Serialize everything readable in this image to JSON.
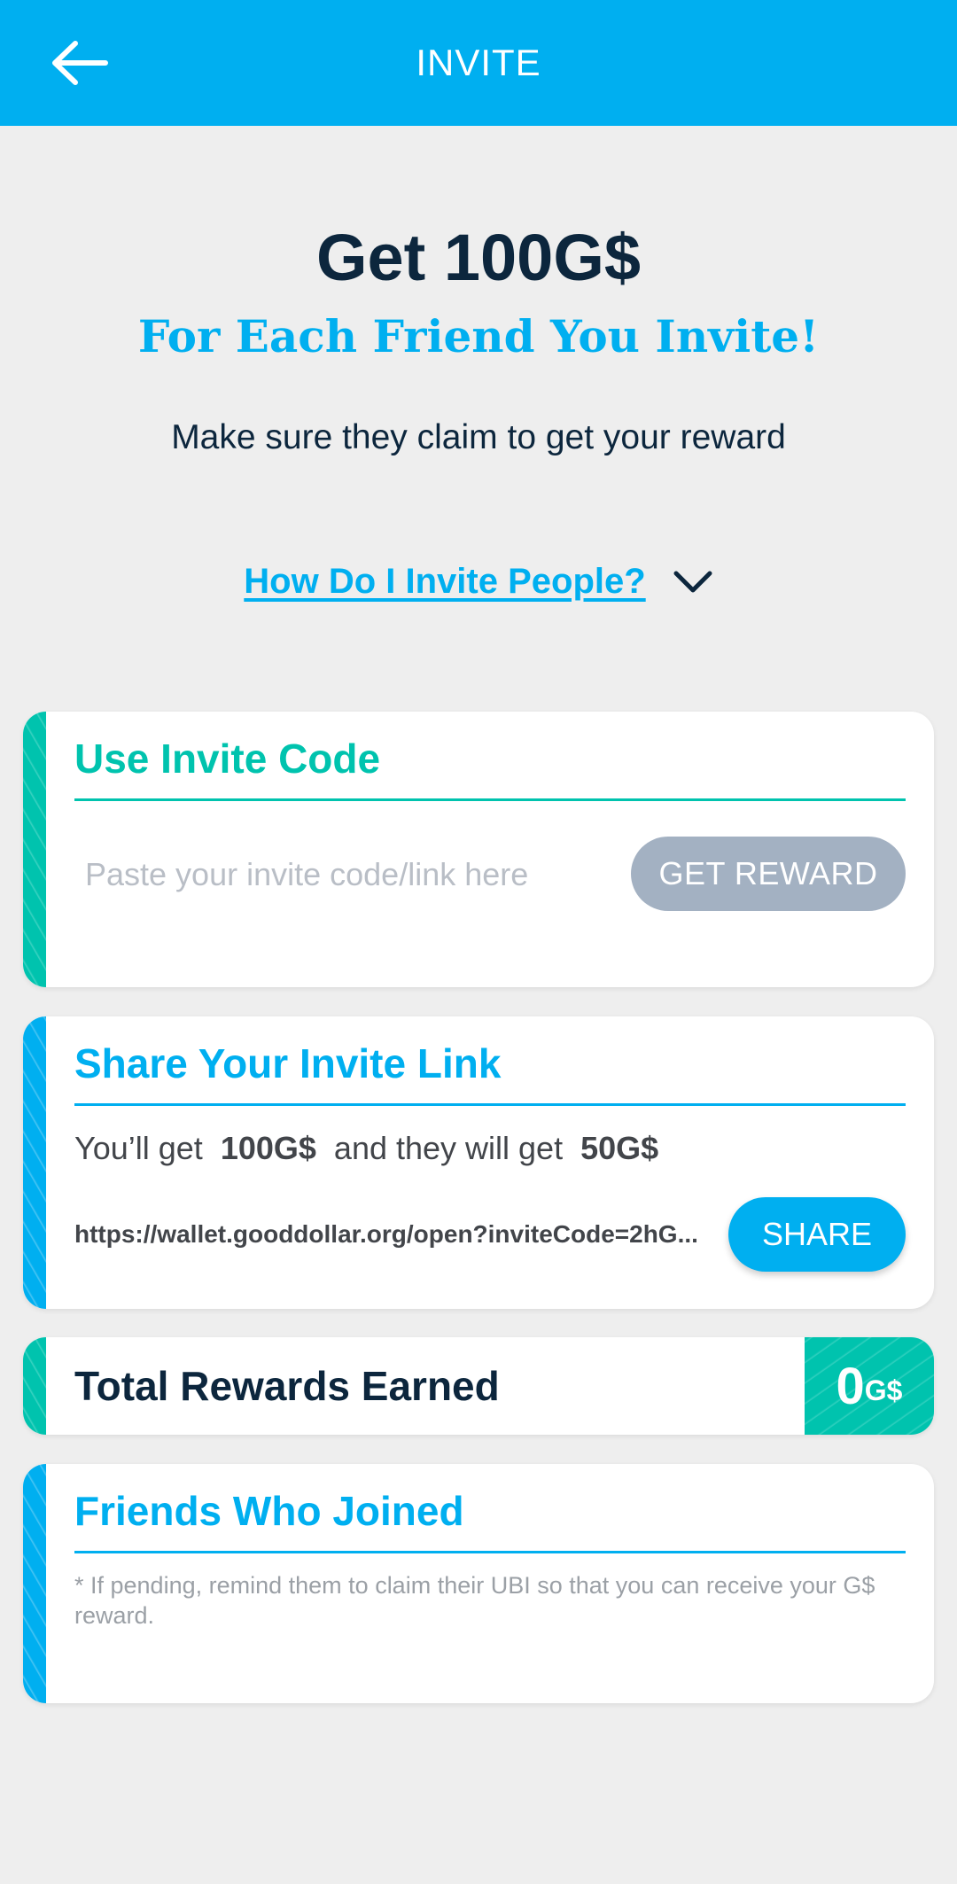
{
  "header": {
    "title": "INVITE",
    "back_icon": "arrow-left-icon"
  },
  "hero": {
    "title": "Get 100G$",
    "subtitle": "For Each Friend You Invite!",
    "description": "Make sure they claim to get your reward"
  },
  "howto": {
    "label": "How Do I Invite People?",
    "icon": "chevron-down-icon"
  },
  "invite_code_card": {
    "heading": "Use Invite Code",
    "placeholder": "Paste your invite code/link here",
    "value": "",
    "button_label": "GET REWARD"
  },
  "share_card": {
    "heading": "Share Your Invite Link",
    "text_prefix": "You’ll get",
    "you_get": "100G$",
    "text_middle": "and they will get",
    "they_get": "50G$",
    "url": "https://wallet.gooddollar.org/open?inviteCode=2hG...",
    "button_label": "SHARE"
  },
  "rewards_card": {
    "label": "Total Rewards Earned",
    "amount": "0",
    "unit": "G$"
  },
  "friends_card": {
    "heading": "Friends Who Joined",
    "note": "* If pending, remind them to claim their UBI so that you can receive your G$ reward."
  },
  "colors": {
    "primary": "#00aff0",
    "green": "#00c3ae",
    "dark": "#0c263d",
    "disabled_button": "#a3b1c2",
    "background": "#eeeeee"
  }
}
